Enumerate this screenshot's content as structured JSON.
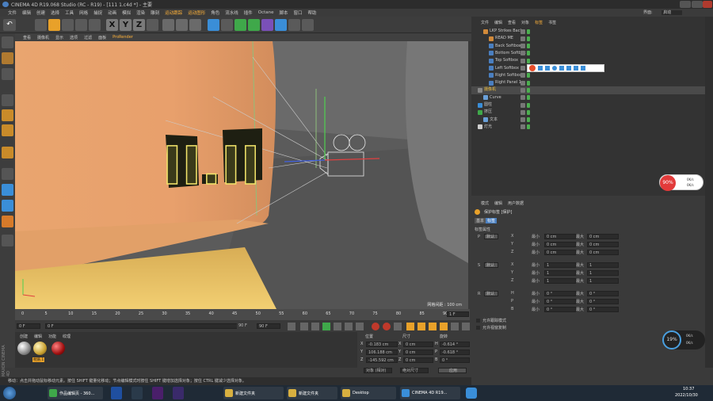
{
  "window": {
    "title": "CINEMA 4D R19.068 Studio (RC - R19) - [111 1.c4d *] - 主要"
  },
  "menu": [
    "文件",
    "编辑",
    "创建",
    "选择",
    "工具",
    "网格",
    "捕捉",
    "动画",
    "模拟",
    "渲染",
    "雕刻",
    "运动跟踪",
    "运动图形",
    "角色",
    "流水线",
    "插件",
    "Octane",
    "脚本",
    "窗口",
    "帮助"
  ],
  "menu_right": {
    "interface_label": "界面:",
    "interface_value": "启动"
  },
  "viewport": {
    "menu": [
      "查看",
      "摄像机",
      "显示",
      "选项",
      "过滤",
      "面板",
      "ProRender"
    ],
    "grid_label": "网格间距 : 100 cm",
    "text_3d": "II.II"
  },
  "timeline": {
    "ticks": [
      "0",
      "5",
      "10",
      "15",
      "20",
      "25",
      "30",
      "35",
      "40",
      "45",
      "50",
      "55",
      "60",
      "65",
      "70",
      "75",
      "80",
      "85",
      "90"
    ],
    "frame_end": "1 F"
  },
  "playbar": {
    "current": "0 F",
    "start": "0 F",
    "end": "90 F",
    "end2": "90 F"
  },
  "materials": {
    "tabs": [
      "创建",
      "编辑",
      "功能",
      "纹理"
    ],
    "items": [
      "",
      "材质.1",
      ""
    ]
  },
  "coords": {
    "headers": [
      "位置",
      "尺寸",
      "旋转"
    ],
    "rows": [
      {
        "axis": "X",
        "pos": "-0.183 cm",
        "size_axis": "X",
        "size": "0 cm",
        "rot_axis": "H",
        "rot": "-0.614 °"
      },
      {
        "axis": "Y",
        "pos": "106.188 cm",
        "size_axis": "Y",
        "size": "0 cm",
        "rot_axis": "P",
        "rot": "-0.618 °"
      },
      {
        "axis": "Z",
        "pos": "-145.592 cm",
        "size_axis": "Z",
        "size": "0 cm",
        "rot_axis": "B",
        "rot": "0 °"
      }
    ],
    "mode1": "对象 (相对)",
    "mode2": "绝对尺寸",
    "apply": "应用"
  },
  "object_manager": {
    "tabs": [
      "文件",
      "编辑",
      "查看",
      "对象",
      "标签",
      "书签"
    ],
    "objects": [
      {
        "name": "LKP Strikes Back",
        "indent": 1,
        "color": "#c9c9c9"
      },
      {
        "name": "READ ME",
        "indent": 2,
        "color": "#c9c9c9"
      },
      {
        "name": "Back Softbox",
        "indent": 2,
        "color": "#c9c9c9"
      },
      {
        "name": "Bottom Softbox",
        "indent": 2,
        "color": "#c9c9c9"
      },
      {
        "name": "Top Softbox",
        "indent": 2,
        "color": "#c9c9c9"
      },
      {
        "name": "Left Softbox",
        "indent": 2,
        "color": "#c9c9c9"
      },
      {
        "name": "Right Softbox",
        "indent": 2,
        "color": "#c9c9c9"
      },
      {
        "name": "Right Panel 1",
        "indent": 2,
        "color": "#c9c9c9"
      },
      {
        "name": "摄像机",
        "indent": 0,
        "color": "#f0c040"
      },
      {
        "name": "Curve",
        "indent": 1,
        "color": "#c9c9c9"
      },
      {
        "name": "圆柱",
        "indent": 0,
        "color": "#c9c9c9"
      },
      {
        "name": "挤压",
        "indent": 0,
        "color": "#c9c9c9"
      },
      {
        "name": "文本",
        "indent": 1,
        "color": "#c9c9c9"
      },
      {
        "name": "灯光",
        "indent": 0,
        "color": "#c9c9c9"
      }
    ]
  },
  "attributes": {
    "tabs": [
      "模式",
      "编辑",
      "用户数据"
    ],
    "title": "保护标签 [保护]",
    "sub_tabs": [
      "基本",
      "标签"
    ],
    "section": "标签属性",
    "groups": [
      {
        "label": "P",
        "mode": "默认",
        "rows": [
          {
            "ax": "X",
            "min": "0 cm",
            "max": "0 cm"
          },
          {
            "ax": "Y",
            "min": "0 cm",
            "max": "0 cm"
          },
          {
            "ax": "Z",
            "min": "0 cm",
            "max": "0 cm"
          }
        ]
      },
      {
        "label": "S",
        "mode": "默认",
        "rows": [
          {
            "ax": "X",
            "min": "1",
            "max": "1"
          },
          {
            "ax": "Y",
            "min": "1",
            "max": "1"
          },
          {
            "ax": "Z",
            "min": "1",
            "max": "1"
          }
        ]
      },
      {
        "label": "R",
        "mode": "默认",
        "rows": [
          {
            "ax": "H",
            "min": "0 °",
            "max": "0 °"
          },
          {
            "ax": "P",
            "min": "0 °",
            "max": "0 °"
          },
          {
            "ax": "B",
            "min": "0 °",
            "max": "0 °"
          }
        ]
      }
    ],
    "min_label": "最小",
    "max_label": "最大",
    "check1": "允许跟踪模式",
    "check2": "允许视窗复制"
  },
  "status_text": "移动：点击并拖动鼠标移动元素。按住 SHIFT 键量化移动；节点编辑模式时按住 SHIFT 键增加选择对象；按住 CTRL 键减少选择对象。",
  "overlay": {
    "percent": "90%",
    "up": "0K/s",
    "down": "0K/s",
    "percent2": "19%",
    "up2": "0K/s",
    "down2": "0K/s"
  },
  "taskbar": {
    "items": [
      "作品编辑页 - 360...",
      "",
      "",
      "",
      "",
      "新建文件夹",
      "新建文件夹",
      "Desktop",
      "CINEMA 4D R19...",
      ""
    ],
    "time": "10:37",
    "date": "2022/10/30"
  }
}
